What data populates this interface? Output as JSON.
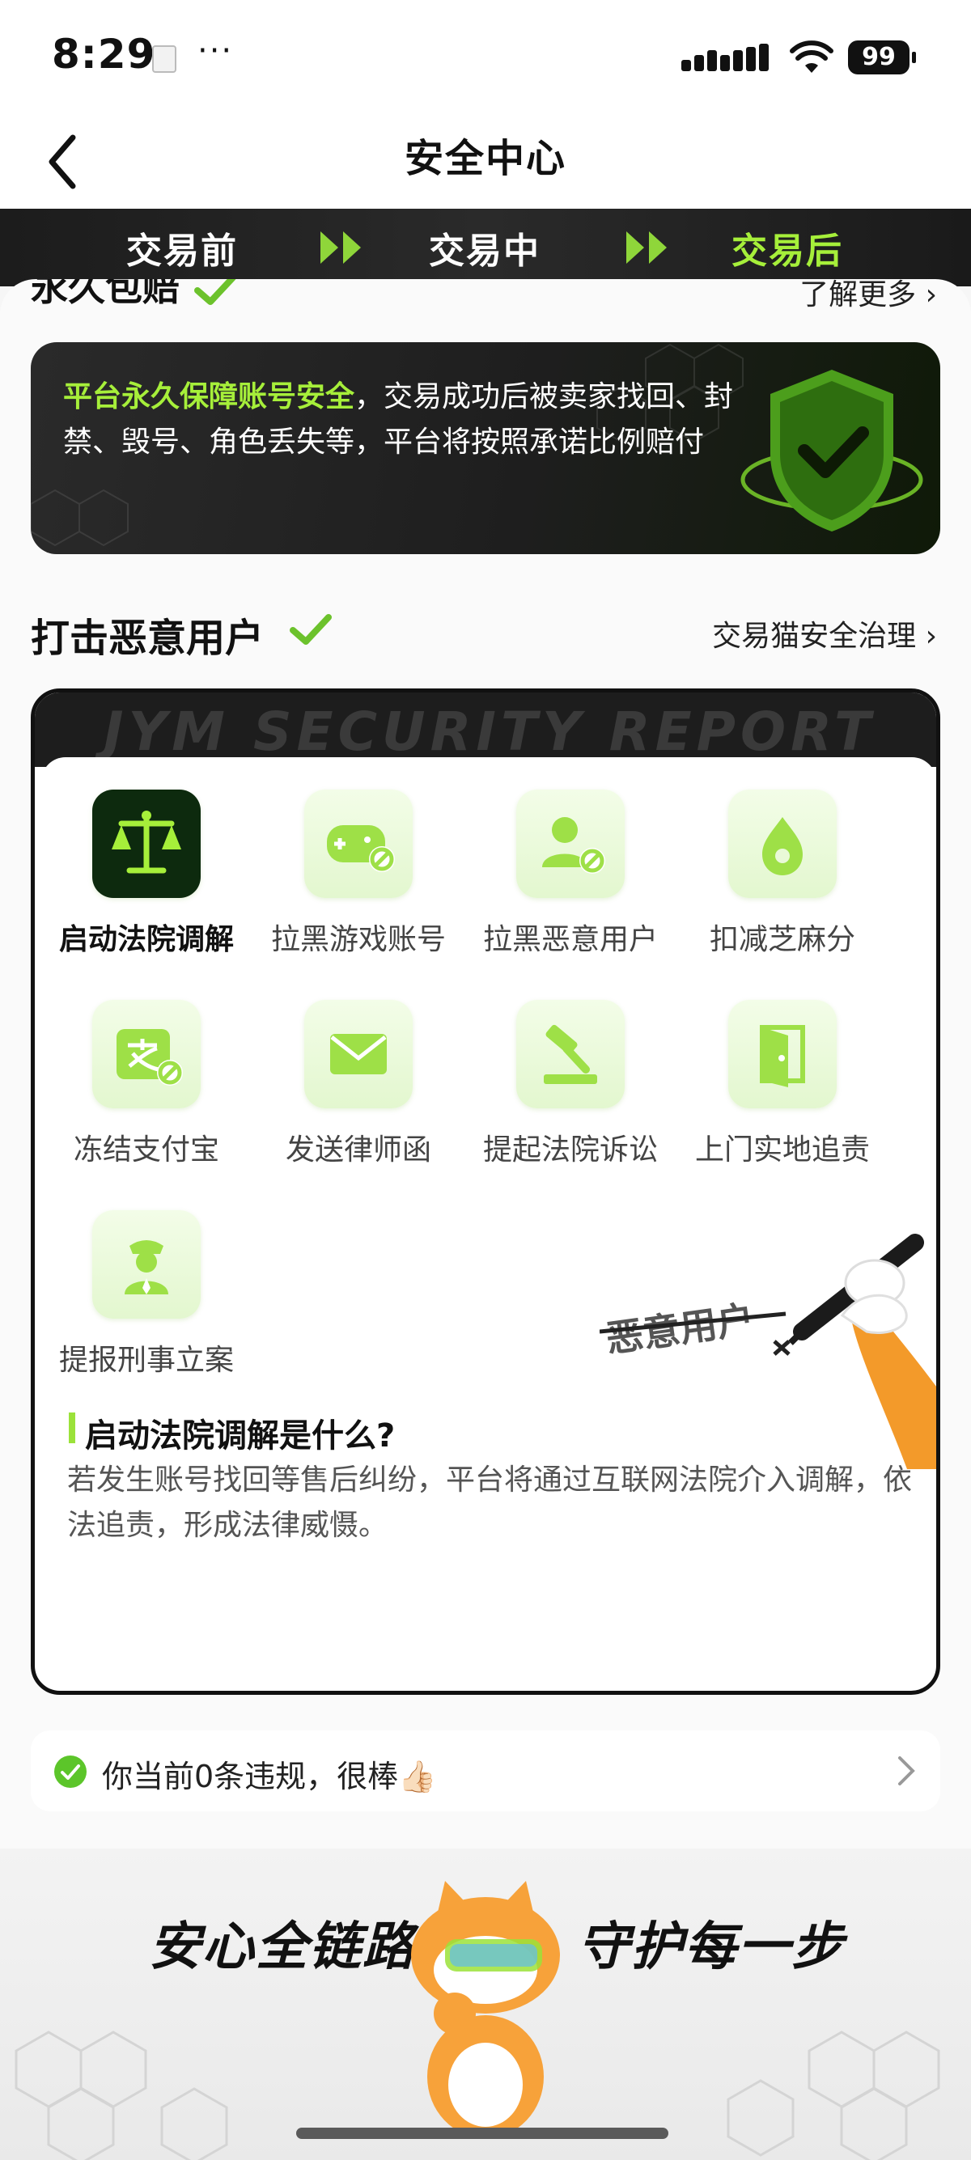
{
  "status": {
    "time": "8:29",
    "more": "···",
    "battery": "99"
  },
  "nav": {
    "title": "安全中心"
  },
  "steps": [
    {
      "label": "交易前"
    },
    {
      "label": "交易中"
    },
    {
      "label": "交易后"
    }
  ],
  "guarantee": {
    "title": "永久包赔",
    "more": "了解更多 ›",
    "highlight": "平台永久保障账号安全",
    "text": "，交易成功后被卖家找回、封禁、毁号、角色丢失等，平台将按照承诺比例赔付"
  },
  "punish": {
    "title": "打击恶意用户",
    "more": "交易猫安全治理 ›",
    "watermark": "JYM   SECURITY   REPORT",
    "items": [
      {
        "label": "启动法院调解",
        "icon": "scale-icon"
      },
      {
        "label": "拉黑游戏账号",
        "icon": "gamepad-block-icon"
      },
      {
        "label": "拉黑恶意用户",
        "icon": "user-block-icon"
      },
      {
        "label": "扣减芝麻分",
        "icon": "sesame-drop-icon"
      },
      {
        "label": "冻结支付宝",
        "icon": "alipay-freeze-icon"
      },
      {
        "label": "发送律师函",
        "icon": "envelope-icon"
      },
      {
        "label": "提起法院诉讼",
        "icon": "gavel-icon"
      },
      {
        "label": "上门实地追责",
        "icon": "door-icon"
      },
      {
        "label": "提报刑事立案",
        "icon": "police-icon"
      }
    ],
    "pen_text": "恶意用户",
    "question": "启动法院调解是什么?",
    "answer": "若发生账号找回等售后纠纷，平台将通过互联网法院介入调解，依法追责，形成法律威慑。"
  },
  "notice": {
    "text": "你当前0条违规，很棒👍🏻"
  },
  "footer": {
    "slogan_left": "安心全链路",
    "slogan_right": "守护每一步"
  },
  "colors": {
    "accent": "#a6ef3a",
    "dark": "#1c1c1c"
  }
}
